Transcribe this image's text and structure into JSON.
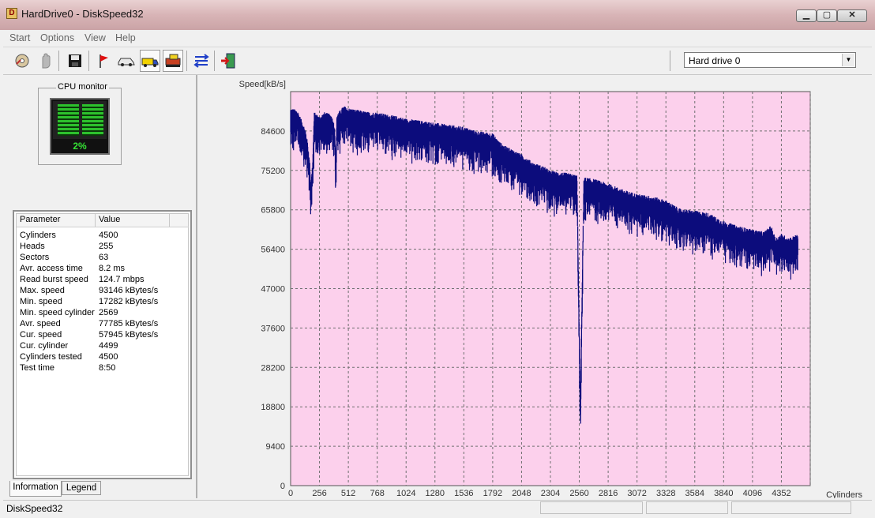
{
  "window": {
    "title": "HardDrive0 - DiskSpeed32",
    "controls": {
      "minimize": "▁",
      "maximize": "▢",
      "close": "✕"
    }
  },
  "menu": [
    "Start",
    "Options",
    "View",
    "Help"
  ],
  "toolbar": {
    "icons": [
      "cd-scan-icon",
      "hand-stop-icon",
      "save-disk-icon",
      "red-flag-icon",
      "car-icon",
      "truck-icon",
      "train-icon",
      "blue-arrows-icon",
      "exit-door-icon"
    ],
    "drive_select": {
      "value": "Hard drive 0",
      "arrow": "▼"
    }
  },
  "cpu_monitor": {
    "title": "CPU monitor",
    "value": "2%"
  },
  "info_table": {
    "headers": [
      "Parameter",
      "Value"
    ],
    "rows": [
      [
        "Cylinders",
        "4500"
      ],
      [
        "Heads",
        "255"
      ],
      [
        "Sectors",
        "63"
      ],
      [
        "Avr. access time",
        "8.2 ms"
      ],
      [
        "Read burst speed",
        "124.7 mbps"
      ],
      [
        "Max. speed",
        "93146 kBytes/s"
      ],
      [
        "Min. speed",
        "17282 kBytes/s"
      ],
      [
        "Min. speed cylinder",
        "2569"
      ],
      [
        "Avr. speed",
        "77785 kBytes/s"
      ],
      [
        "Cur. speed",
        "57945 kBytes/s"
      ],
      [
        "Cur. cylinder",
        "4499"
      ],
      [
        "Cylinders tested",
        "4500"
      ],
      [
        "Test time",
        "8:50"
      ]
    ]
  },
  "tabs": [
    "Information",
    "Legend"
  ],
  "status": {
    "text": "DiskSpeed32"
  },
  "colors": {
    "plot_background": "#fcd0ec",
    "series": "#0c0c7c",
    "grid": "#707070"
  },
  "chart_data": {
    "type": "line",
    "ylabel": "Speed[kB/s]",
    "xlabel": "Cylinders",
    "xlim": [
      0,
      4500
    ],
    "ylim": [
      0,
      94000
    ],
    "x_ticks": [
      0,
      256,
      512,
      768,
      1024,
      1280,
      1536,
      1792,
      2048,
      2304,
      2560,
      2816,
      3072,
      3328,
      3584,
      3840,
      4096,
      4352
    ],
    "y_ticks": [
      0,
      9400,
      18800,
      28200,
      37600,
      47000,
      56400,
      65800,
      75200,
      84600
    ],
    "grid": true,
    "series": [
      {
        "points": [
          [
            0,
            88000
          ],
          [
            60,
            87500
          ],
          [
            100,
            85000
          ],
          [
            130,
            83000
          ],
          [
            150,
            80000
          ],
          [
            170,
            75000
          ],
          [
            180,
            70000
          ],
          [
            195,
            75000
          ],
          [
            210,
            87000
          ],
          [
            256,
            86000
          ],
          [
            300,
            87000
          ],
          [
            360,
            86500
          ],
          [
            390,
            84000
          ],
          [
            400,
            75000
          ],
          [
            410,
            86500
          ],
          [
            470,
            88500
          ],
          [
            512,
            88000
          ],
          [
            600,
            87500
          ],
          [
            700,
            87000
          ],
          [
            768,
            87000
          ],
          [
            850,
            86500
          ],
          [
            950,
            86000
          ],
          [
            1024,
            85500
          ],
          [
            1150,
            85000
          ],
          [
            1280,
            84500
          ],
          [
            1400,
            84000
          ],
          [
            1536,
            83500
          ],
          [
            1650,
            82500
          ],
          [
            1792,
            82000
          ],
          [
            1850,
            80000
          ],
          [
            1900,
            79000
          ],
          [
            2048,
            77000
          ],
          [
            2150,
            75000
          ],
          [
            2250,
            74000
          ],
          [
            2304,
            73000
          ],
          [
            2450,
            72500
          ],
          [
            2540,
            72000
          ],
          [
            2569,
            17282
          ],
          [
            2600,
            71500
          ],
          [
            2700,
            71000
          ],
          [
            2816,
            70000
          ],
          [
            2950,
            68500
          ],
          [
            3072,
            67500
          ],
          [
            3200,
            67000
          ],
          [
            3328,
            66000
          ],
          [
            3450,
            64000
          ],
          [
            3584,
            63500
          ],
          [
            3700,
            63000
          ],
          [
            3840,
            61000
          ],
          [
            3950,
            60000
          ],
          [
            4096,
            59000
          ],
          [
            4200,
            58500
          ],
          [
            4260,
            60000
          ],
          [
            4300,
            57000
          ],
          [
            4352,
            58000
          ],
          [
            4420,
            57000
          ],
          [
            4499,
            57945
          ]
        ],
        "noise_band": 6000
      }
    ]
  }
}
